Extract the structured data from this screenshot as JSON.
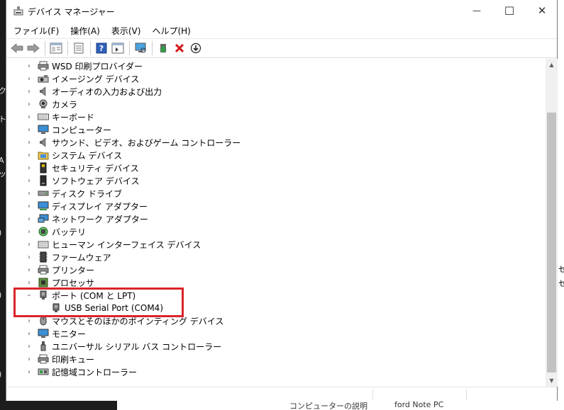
{
  "window": {
    "title": "デバイス マネージャー",
    "controls": {
      "minimize": "—",
      "maximize": "☐",
      "close": "✕"
    }
  },
  "menu": [
    "ファイル(F)",
    "操作(A)",
    "表示(V)",
    "ヘルプ(H)"
  ],
  "toolbar_icons": [
    "back-arrow-icon",
    "forward-arrow-icon",
    "properties-icon",
    "help-icon",
    "scan-hardware-icon",
    "update-driver-icon",
    "disable-device-icon",
    "uninstall-icon",
    "enable-icon"
  ],
  "tree": [
    {
      "label": "WSD 印刷プロバイダー",
      "icon": "printer-icon",
      "expanded": false
    },
    {
      "label": "イメージング デバイス",
      "icon": "camera-scanner-icon",
      "expanded": false
    },
    {
      "label": "オーディオの入力および出力",
      "icon": "speaker-icon",
      "expanded": false
    },
    {
      "label": "カメラ",
      "icon": "webcam-icon",
      "expanded": false
    },
    {
      "label": "キーボード",
      "icon": "keyboard-icon",
      "expanded": false
    },
    {
      "label": "コンピューター",
      "icon": "monitor-icon",
      "expanded": false
    },
    {
      "label": "サウンド、ビデオ、およびゲーム コントローラー",
      "icon": "speaker-icon",
      "expanded": false
    },
    {
      "label": "システム デバイス",
      "icon": "system-folder-icon",
      "expanded": false
    },
    {
      "label": "セキュリティ デバイス",
      "icon": "security-device-icon",
      "expanded": false
    },
    {
      "label": "ソフトウェア デバイス",
      "icon": "software-device-icon",
      "expanded": false
    },
    {
      "label": "ディスク ドライブ",
      "icon": "disk-drive-icon",
      "expanded": false
    },
    {
      "label": "ディスプレイ アダプター",
      "icon": "display-adapter-icon",
      "expanded": false
    },
    {
      "label": "ネットワーク アダプター",
      "icon": "network-adapter-icon",
      "expanded": false
    },
    {
      "label": "バッテリ",
      "icon": "battery-icon",
      "expanded": false
    },
    {
      "label": "ヒューマン インターフェイス デバイス",
      "icon": "hid-icon",
      "expanded": false
    },
    {
      "label": "ファームウェア",
      "icon": "firmware-icon",
      "expanded": false
    },
    {
      "label": "プリンター",
      "icon": "printer-icon",
      "expanded": false
    },
    {
      "label": "プロセッサ",
      "icon": "processor-icon",
      "expanded": false
    },
    {
      "label": "ポート (COM と LPT)",
      "icon": "port-icon",
      "expanded": true,
      "children": [
        {
          "label": "USB Serial Port (COM4)",
          "icon": "port-icon"
        }
      ]
    },
    {
      "label": "マウスとそのほかのポインティング デバイス",
      "icon": "mouse-icon",
      "expanded": false
    },
    {
      "label": "モニター",
      "icon": "monitor-icon",
      "expanded": false
    },
    {
      "label": "ユニバーサル シリアル バス コントローラー",
      "icon": "usb-icon",
      "expanded": false
    },
    {
      "label": "印刷キュー",
      "icon": "print-queue-icon",
      "expanded": false
    },
    {
      "label": "記憶域コントローラー",
      "icon": "storage-controller-icon",
      "expanded": false
    }
  ],
  "highlight_color": "#d9242a",
  "background_fragments": {
    "left_chars": [
      "ク",
      "ト",
      "A",
      "ッ",
      ")",
      ")",
      ")"
    ],
    "right_chars": [
      "セ",
      "セ"
    ],
    "bottom_texts": [
      "コンピューターの説明",
      "ford Note PC"
    ]
  }
}
